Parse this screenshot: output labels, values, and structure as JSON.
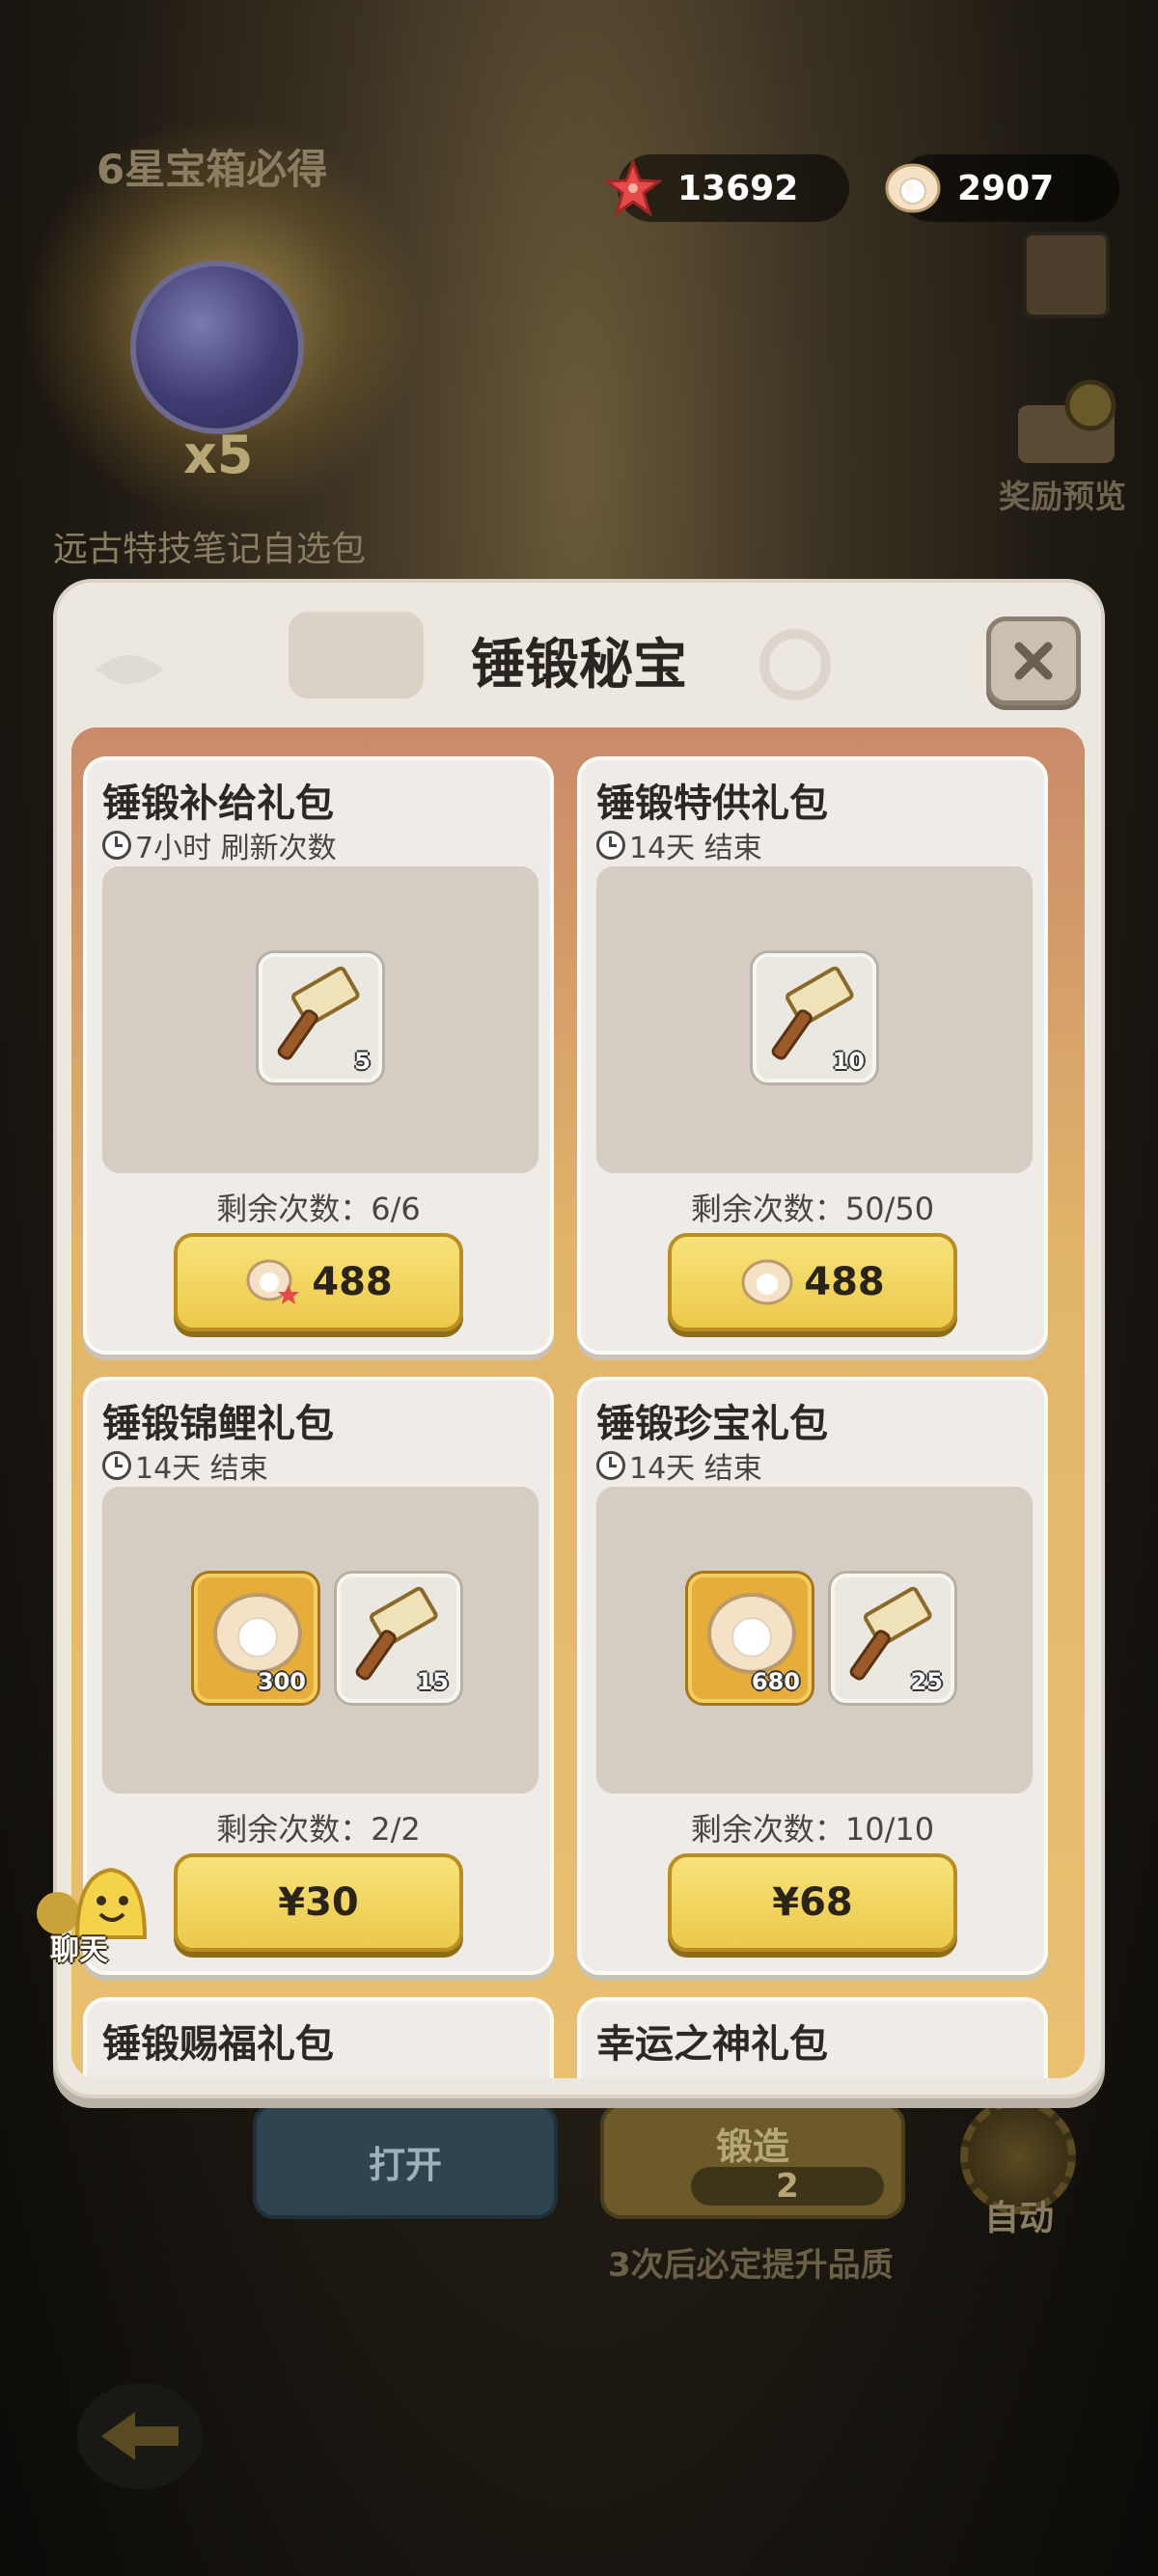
{
  "scene": {
    "banner": "6星宝箱必得",
    "reward_multiplier": "x5",
    "reward_name": "远古特技笔记自选包",
    "preview_label": "奖励预览",
    "open_button": "打开",
    "forge_button": "锻造",
    "forge_count": "2",
    "forge_hint": "3次后必定提升品质",
    "auto_label": "自动",
    "chat_label": "聊天"
  },
  "currency": {
    "starfish": {
      "icon": "starfish-icon",
      "value": "13692"
    },
    "pearl": {
      "icon": "pearl-icon",
      "value": "2907"
    }
  },
  "dialog": {
    "title": "锤锻秘宝",
    "close_icon": "close-icon",
    "cards": [
      {
        "name": "锤锻补给礼包",
        "timer": "7小时 刷新次数",
        "items": [
          {
            "icon": "hammer-icon",
            "qty": "5"
          }
        ],
        "remaining": "剩余次数：6/6",
        "price": "488",
        "price_icon": "pearl-starfish-icon"
      },
      {
        "name": "锤锻特供礼包",
        "timer": "14天 结束",
        "items": [
          {
            "icon": "hammer-icon",
            "qty": "10"
          }
        ],
        "remaining": "剩余次数：50/50",
        "price": "488",
        "price_icon": "pearl-icon"
      },
      {
        "name": "锤锻锦鲤礼包",
        "timer": "14天 结束",
        "items": [
          {
            "icon": "pearl-icon",
            "qty": "300"
          },
          {
            "icon": "hammer-icon",
            "qty": "15"
          }
        ],
        "remaining": "剩余次数：2/2",
        "price": "¥30"
      },
      {
        "name": "锤锻珍宝礼包",
        "timer": "14天 结束",
        "items": [
          {
            "icon": "pearl-icon",
            "qty": "680"
          },
          {
            "icon": "hammer-icon",
            "qty": "25"
          }
        ],
        "remaining": "剩余次数：10/10",
        "price": "¥68"
      },
      {
        "name": "锤锻赐福礼包"
      },
      {
        "name": "幸运之神礼包"
      }
    ]
  }
}
